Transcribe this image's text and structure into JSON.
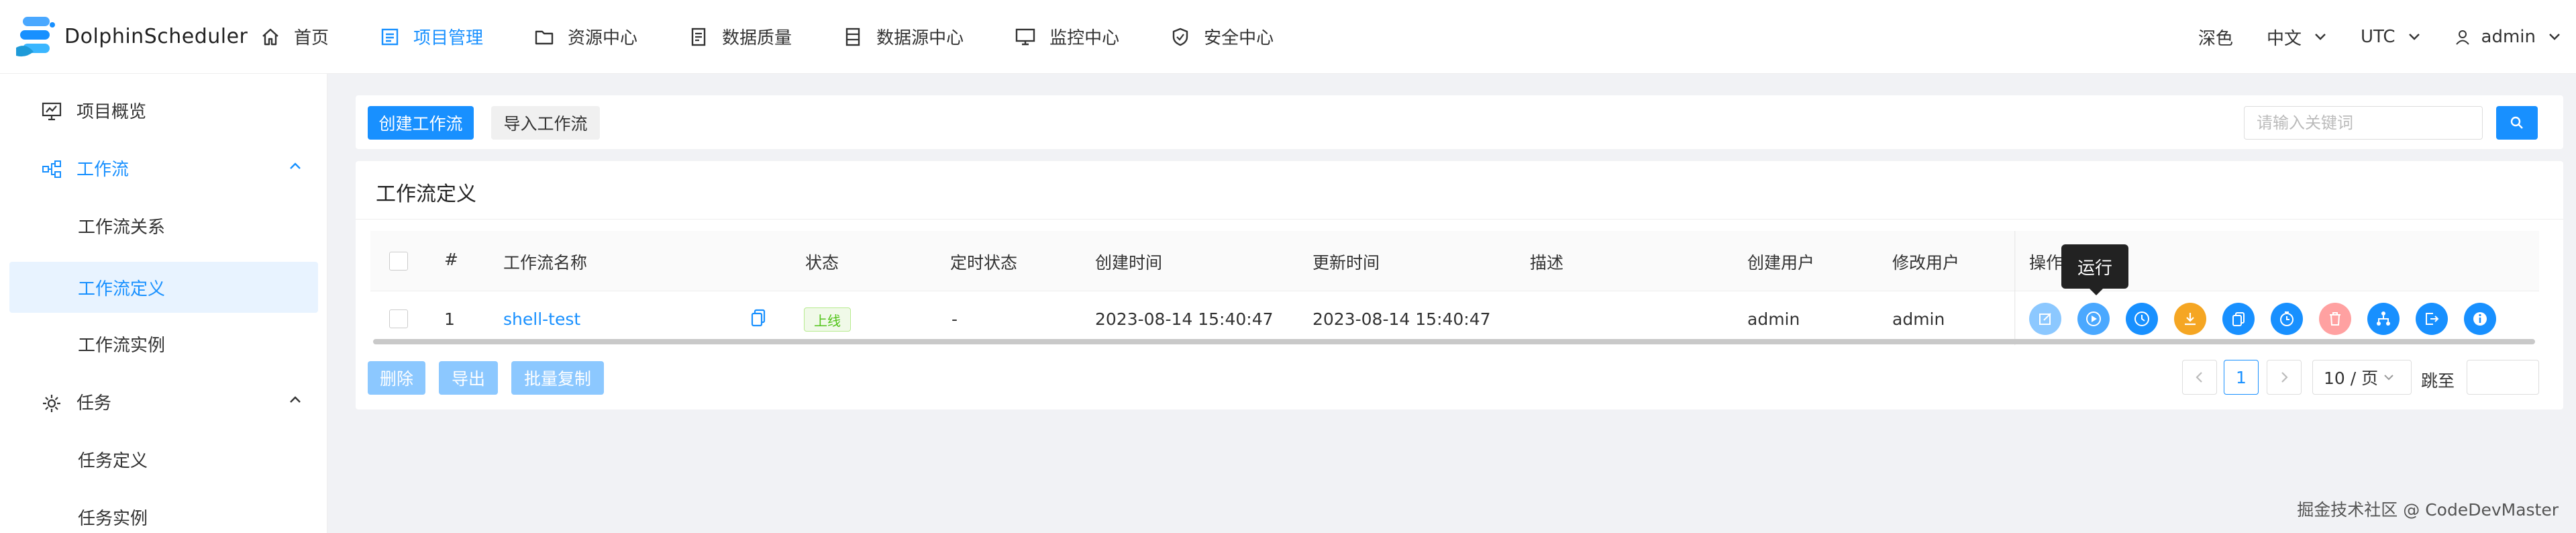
{
  "app": {
    "name": "DolphinScheduler"
  },
  "nav": {
    "items": [
      {
        "label": "首页",
        "icon": "home-icon"
      },
      {
        "label": "项目管理",
        "icon": "project-icon"
      },
      {
        "label": "资源中心",
        "icon": "folder-icon"
      },
      {
        "label": "数据质量",
        "icon": "document-icon"
      },
      {
        "label": "数据源中心",
        "icon": "database-icon"
      },
      {
        "label": "监控中心",
        "icon": "monitor-icon"
      },
      {
        "label": "安全中心",
        "icon": "shield-icon"
      }
    ],
    "active_index": 1
  },
  "header_right": {
    "theme": "深色",
    "language": "中文",
    "timezone": "UTC",
    "user": "admin"
  },
  "sidebar": {
    "items": [
      {
        "label": "项目概览"
      },
      {
        "label": "工作流"
      },
      {
        "label": "工作流关系"
      },
      {
        "label": "工作流定义"
      },
      {
        "label": "工作流实例"
      },
      {
        "label": "任务"
      },
      {
        "label": "任务定义"
      },
      {
        "label": "任务实例"
      }
    ]
  },
  "toolbar": {
    "create_label": "创建工作流",
    "import_label": "导入工作流",
    "search_placeholder": "请输入关键词"
  },
  "card": {
    "title": "工作流定义"
  },
  "table": {
    "columns": [
      "#",
      "工作流名称",
      "状态",
      "定时状态",
      "创建时间",
      "更新时间",
      "描述",
      "创建用户",
      "修改用户",
      "操作"
    ],
    "rows": [
      {
        "index": "1",
        "name": "shell-test",
        "status": "上线",
        "schedule_status": "-",
        "created": "2023-08-14 15:40:47",
        "updated": "2023-08-14 15:40:47",
        "description": "",
        "creator": "admin",
        "modifier": "admin"
      }
    ]
  },
  "row_actions": [
    {
      "icon": "edit-icon",
      "color": "#8cc8ff"
    },
    {
      "icon": "play-icon",
      "color": "#4aa8ff"
    },
    {
      "icon": "clock-icon",
      "color": "#1890ff"
    },
    {
      "icon": "download-icon",
      "color": "#f5a623"
    },
    {
      "icon": "copy-icon",
      "color": "#1890ff"
    },
    {
      "icon": "timer-icon",
      "color": "#1890ff"
    },
    {
      "icon": "delete-icon",
      "color": "#ffa1a1"
    },
    {
      "icon": "tree-icon",
      "color": "#1890ff"
    },
    {
      "icon": "export-icon",
      "color": "#1890ff"
    },
    {
      "icon": "info-icon",
      "color": "#1890ff"
    }
  ],
  "tooltip": {
    "text": "运行"
  },
  "bulk_actions": {
    "delete": "删除",
    "export": "导出",
    "batch_copy": "批量复制"
  },
  "pagination": {
    "current_page": "1",
    "page_size": "10 / 页",
    "jump_label": "跳至",
    "jump_value": ""
  },
  "watermark": "掘金技术社区 @ CodeDevMaster",
  "colors": {
    "primary": "#1890ff",
    "success": "#52c41a",
    "warning": "#f5a623",
    "danger": "#ff7875"
  }
}
